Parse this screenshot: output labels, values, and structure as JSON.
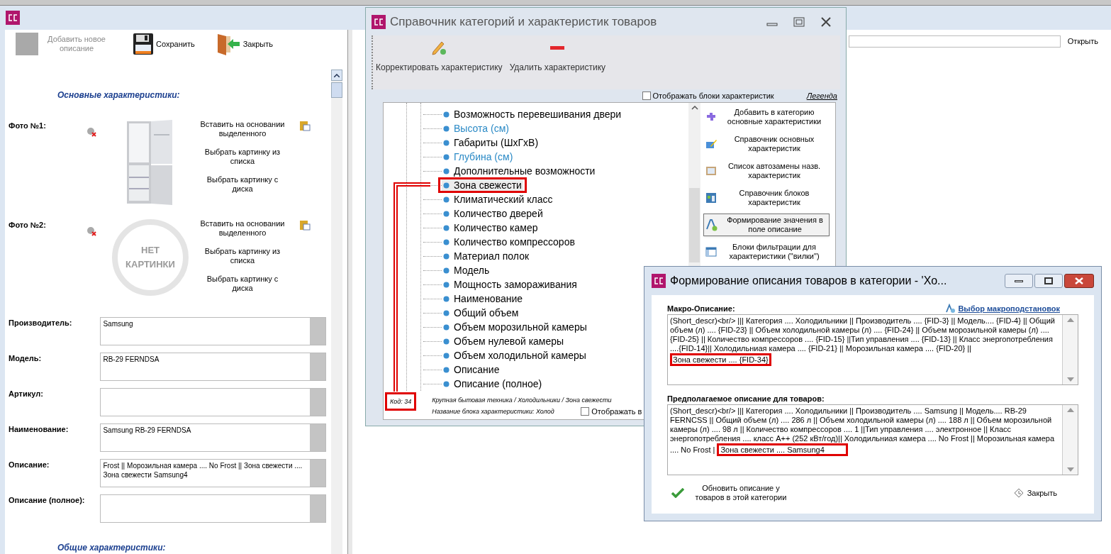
{
  "main_window": {
    "toolbar": [
      {
        "label": "Добавить новое описание",
        "disabled": true,
        "kind": "blank"
      },
      {
        "label": "Сохранить",
        "disabled": false,
        "kind": "save"
      },
      {
        "label": "Закрыть",
        "disabled": false,
        "kind": "exit"
      }
    ],
    "section_main": "Основные характеристики:",
    "photos": [
      {
        "label": "Фото №1:",
        "has_image": true,
        "actions": [
          "Вставить на основании выделенного",
          "Выбрать картинку из списка",
          "Выбрать картинку с диска"
        ]
      },
      {
        "label": "Фото №2:",
        "has_image": false,
        "no_image_text": [
          "НЕТ",
          "КАРТИНКИ"
        ],
        "actions": [
          "Вставить на основании выделенного",
          "Выбрать картинку из списка",
          "Выбрать картинку с диска"
        ]
      }
    ],
    "fields": [
      {
        "label": "Производитель:",
        "value": "Samsung"
      },
      {
        "label": "Модель:",
        "value": "RB-29 FERNDSA"
      },
      {
        "label": "Артикул:"
      },
      {
        "label": "Наименование:",
        "value": "Samsung RB-29 FERNDSA"
      },
      {
        "label": "Описание:",
        "value": "Frost || Морозильная камера ....  No Frost || Зона свежести ....   Зона свежести Samsung4"
      },
      {
        "label": "Описание (полное):"
      }
    ],
    "section_common": "Общие характеристики:",
    "open_button": "Открыть"
  },
  "catalog_window": {
    "title": "Справочник категорий и характеристик товаров",
    "toolbar": [
      {
        "label": "Корректировать характеристику",
        "kind": "edit"
      },
      {
        "label": "Удалить характеристику",
        "kind": "delete"
      }
    ],
    "show_blocks": {
      "label": "Отображать блоки характеристик",
      "checked": false
    },
    "legend": "Легенда",
    "tree_items": [
      {
        "label": "Возможность перевешивания двери",
        "color": "#000000",
        "selected": false
      },
      {
        "label": "Высота (см)",
        "color": "#2b8ac6",
        "selected": false
      },
      {
        "label": "Габариты (ШхГхВ)",
        "color": "#000000",
        "selected": false
      },
      {
        "label": "Глубина (см)",
        "color": "#2b8ac6",
        "selected": false
      },
      {
        "label": "Дополнительные возможности",
        "color": "#000000",
        "selected": false
      },
      {
        "label": "Зона свежести",
        "color": "#000000",
        "selected": true
      },
      {
        "label": "Климатический класс",
        "color": "#000000",
        "selected": false
      },
      {
        "label": "Количество дверей",
        "color": "#000000",
        "selected": false
      },
      {
        "label": "Количество камер",
        "color": "#000000",
        "selected": false
      },
      {
        "label": "Количество компрессоров",
        "color": "#000000",
        "selected": false
      },
      {
        "label": "Материал полок",
        "color": "#000000",
        "selected": false
      },
      {
        "label": "Модель",
        "color": "#000000",
        "selected": false
      },
      {
        "label": "Мощность замораживания",
        "color": "#000000",
        "selected": false
      },
      {
        "label": "Наименование",
        "color": "#000000",
        "selected": false
      },
      {
        "label": "Общий объем",
        "color": "#000000",
        "selected": false
      },
      {
        "label": "Объем морозильной камеры",
        "color": "#000000",
        "selected": false
      },
      {
        "label": "Объем нулевой камеры",
        "color": "#000000",
        "selected": false
      },
      {
        "label": "Объем холодильной камеры",
        "color": "#000000",
        "selected": false
      },
      {
        "label": "Описание",
        "color": "#000000",
        "selected": false
      },
      {
        "label": "Описание (полное)",
        "color": "#000000",
        "selected": false
      }
    ],
    "side_actions": [
      {
        "label": "Добавить в категорию основные характеристики",
        "kind": "puzzle",
        "selected": false
      },
      {
        "label": "Справочник основных характеристик",
        "kind": "edit",
        "selected": false
      },
      {
        "label": "Список автозамены назв. характеристик",
        "kind": "list",
        "selected": false
      },
      {
        "label": "Справочник блоков характеристик",
        "kind": "blocks",
        "selected": false
      },
      {
        "label": "Формирование значения в поле описание",
        "kind": "format",
        "selected": true
      },
      {
        "label": "Блоки фильтрации для характеристики (\"вилки\")",
        "kind": "table",
        "selected": false
      }
    ],
    "code": "Код: 34",
    "path": "Крупная бытовая техника / Холодильники / Зона свежести",
    "block_name": "Название блока характеристики: Холод",
    "show_bottom": {
      "label": "Отображать в",
      "checked": false
    }
  },
  "description_dialog": {
    "title": "Формирование описания товаров в категории - 'Хо...",
    "macro_label": "Макро-Описание:",
    "macro_link": "Выбор макроподстановок",
    "macro_text": "(Short_descr)<br/>  ||| Категория .... Холодильники || Производитель .... {FID-3} || Модель.... {FID-4} || Общий объем (л) .... {FID-23} || Объем холодильной камеры (л) .... {FID-24} || Объем морозильной камеры (л) .... {FID-25} || Количество компрессоров .... {FID-15} ||Тип управления .... {FID-13} || Класс энергопотребления ....{FID-14}|| Холодильниая камера .... {FID-21} || Морозильная камера ....  {FID-20} ||",
    "macro_highlight": "Зона свежести ....   {FID-34}",
    "result_label": "Предполагаемое описание для товаров:",
    "result_text": "(Short_descr)<br/>  ||| Категория .... Холодильники || Производитель .... Samsung || Модель.... RB-29 FERNCSS || Общий объем (л) .... 286 л || Объем холодильной камеры (л) .... 188 л || Объем морозильной камеры (л) .... 98 л || Количество компрессоров .... 1 ||Тип управления .... электронное || Класс энергопотребления .... класс A++ (252 кВт/год)|| Холодильниая камера .... No Frost || Морозильная камера ....  No Frost |",
    "result_highlight": "Зона свежести ....   Samsung4",
    "update_button": "Обновить описание у товаров в этой категории",
    "close_button": "Закрыть"
  }
}
